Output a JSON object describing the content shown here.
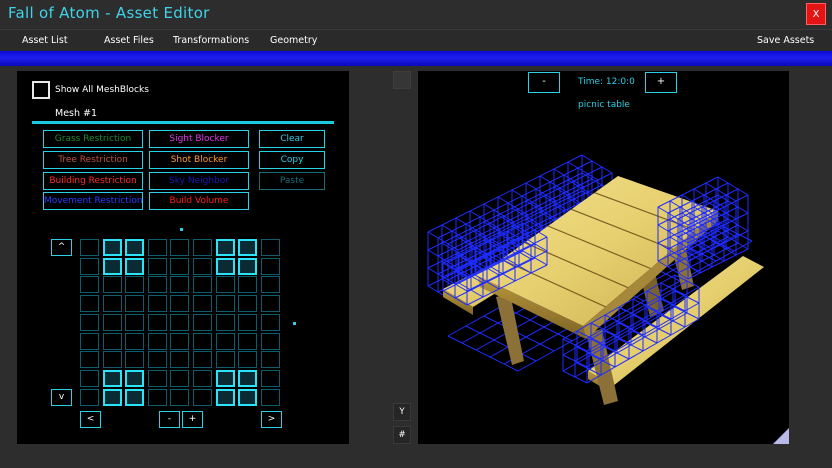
{
  "app": {
    "title": "Fall of Atom - Asset Editor",
    "close_label": "X"
  },
  "menu": [
    {
      "label": "Asset List"
    },
    {
      "label": "Asset Files"
    },
    {
      "label": "Transformations"
    },
    {
      "label": "Geometry"
    }
  ],
  "save_label": "Save Assets",
  "left": {
    "show_all_label": "Show All MeshBlocks",
    "show_all_checked": false,
    "mesh_label": "Mesh #1",
    "buttons": {
      "grass": {
        "label": "Grass Restriction",
        "color": "#1e8a32"
      },
      "tree": {
        "label": "Tree Restriction",
        "color": "#c0533a"
      },
      "building": {
        "label": "Building Restriction",
        "color": "#ff2a2a"
      },
      "movement": {
        "label": "Movement Restriction",
        "color": "#2a3cff"
      },
      "sight": {
        "label": "Sight Blocker",
        "color": "#e038e8"
      },
      "shot": {
        "label": "Shot Blocker",
        "color": "#ff9a2a"
      },
      "third": {
        "label": "Sky Neighbor",
        "color": "#1818b8"
      },
      "build_volume": {
        "label": "Build Volume",
        "color": "#ff1a1a"
      },
      "clear": {
        "label": "Clear",
        "color": "#2ad0e6"
      },
      "copy": {
        "label": "Copy",
        "color": "#2ad0e6"
      },
      "paste": {
        "label": "Paste",
        "color": "#1b6a78"
      }
    },
    "grid": {
      "rows": 9,
      "cols": 9,
      "active": [
        [
          0,
          1
        ],
        [
          0,
          2
        ],
        [
          0,
          6
        ],
        [
          0,
          7
        ],
        [
          1,
          1
        ],
        [
          1,
          2
        ],
        [
          1,
          6
        ],
        [
          1,
          7
        ],
        [
          7,
          1
        ],
        [
          7,
          2
        ],
        [
          7,
          6
        ],
        [
          7,
          7
        ],
        [
          8,
          1
        ],
        [
          8,
          2
        ],
        [
          8,
          6
        ],
        [
          8,
          7
        ]
      ]
    },
    "nav": {
      "up": "^",
      "down": "v",
      "left": "<",
      "right": ">",
      "minus": "-",
      "plus": "+"
    }
  },
  "axis": {
    "y": "Y",
    "hash": "#"
  },
  "viewport": {
    "time_minus": "-",
    "time_label": "Time: 12:0:0",
    "time_plus": "+",
    "asset_name": "picnic table"
  },
  "colors": {
    "accent": "#2ad0e6",
    "title": "#3fd4ea",
    "strip": "#1a1ae6",
    "wire": "#1f2cff",
    "wood": "#e8d27a"
  }
}
